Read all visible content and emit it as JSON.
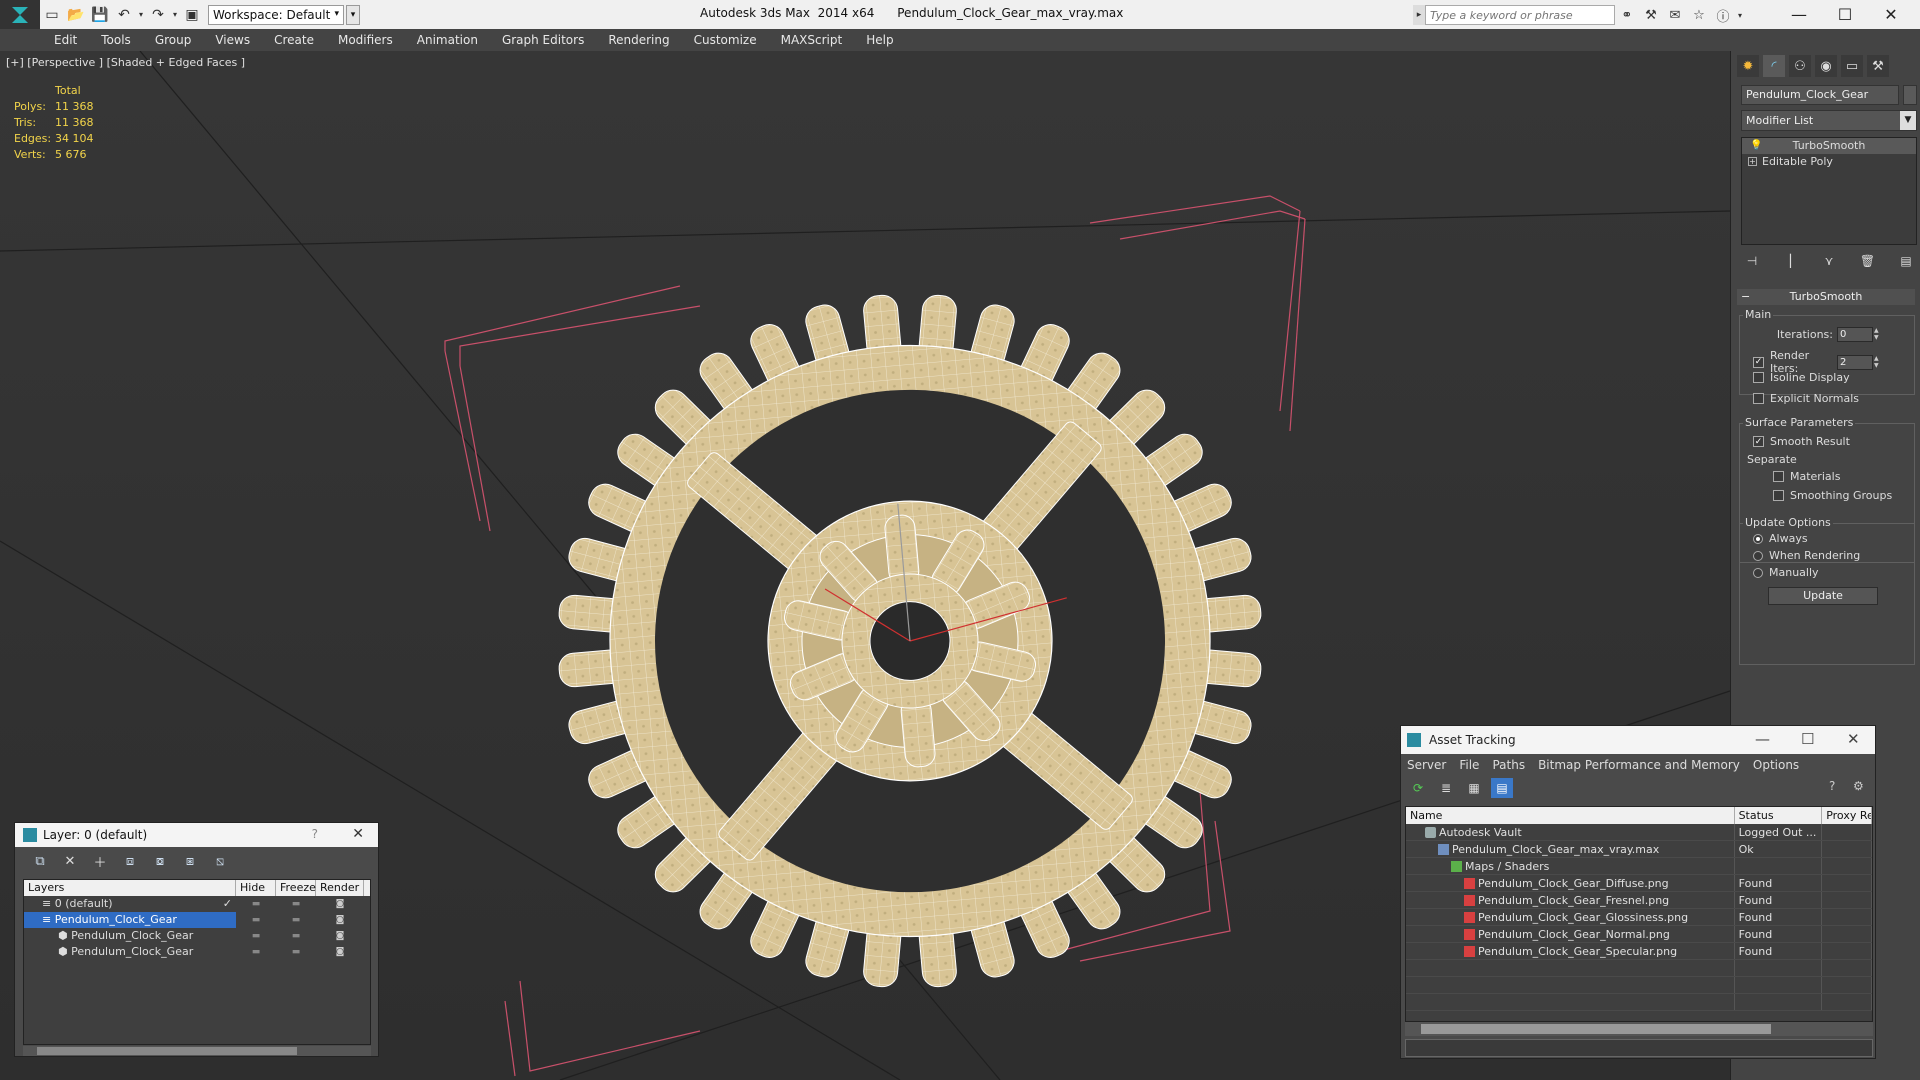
{
  "titlebar": {
    "workspace": "Workspace: Default",
    "app": "Autodesk 3ds Max  2014 x64",
    "file": "Pendulum_Clock_Gear_max_vray.max",
    "search_placeholder": "Type a keyword or phrase"
  },
  "menu": [
    "Edit",
    "Tools",
    "Group",
    "Views",
    "Create",
    "Modifiers",
    "Animation",
    "Graph Editors",
    "Rendering",
    "Customize",
    "MAXScript",
    "Help"
  ],
  "viewport": {
    "label": "[+] [Perspective ] [Shaded + Edged Faces ]",
    "stats": {
      "header": "Total",
      "rows": [
        {
          "k": "Polys:",
          "v": "11 368"
        },
        {
          "k": "Tris:",
          "v": "11 368"
        },
        {
          "k": "Edges:",
          "v": "34 104"
        },
        {
          "k": "Verts:",
          "v": "5 676"
        }
      ]
    }
  },
  "cmdpanel": {
    "object_name": "Pendulum_Clock_Gear",
    "modifier_list": "Modifier List",
    "stack": [
      "TurboSmooth",
      "Editable Poly"
    ],
    "rollout": "TurboSmooth",
    "main_label": "Main",
    "iterations_label": "Iterations:",
    "iterations_value": "0",
    "render_iters_label": "Render Iters:",
    "render_iters_value": "2",
    "isoline": "Isoline Display",
    "explicit_normals": "Explicit Normals",
    "surface_params": "Surface Parameters",
    "smooth_result": "Smooth Result",
    "separate": "Separate",
    "materials": "Materials",
    "smoothing_groups": "Smoothing Groups",
    "update_options": "Update Options",
    "always": "Always",
    "when_rendering": "When Rendering",
    "manually": "Manually",
    "update_button": "Update"
  },
  "layer_dialog": {
    "title": "Layer: 0 (default)",
    "help": "?",
    "headers": [
      "Layers",
      "Hide",
      "Freeze",
      "Render"
    ],
    "rows": [
      {
        "name": "0 (default)",
        "indent": 1
      },
      {
        "name": "Pendulum_Clock_Gear",
        "indent": 1
      },
      {
        "name": "Pendulum_Clock_Gear",
        "indent": 2
      },
      {
        "name": "Pendulum_Clock_Gear",
        "indent": 2
      }
    ]
  },
  "asset_dialog": {
    "title": "Asset Tracking",
    "menu": [
      "Server",
      "File",
      "Paths",
      "Bitmap Performance and Memory",
      "Options"
    ],
    "headers": [
      "Name",
      "Status",
      "Proxy Re"
    ],
    "rows": [
      {
        "name": "Autodesk Vault",
        "status": "Logged Out ...",
        "icon": "vault",
        "indent": 1
      },
      {
        "name": "Pendulum_Clock_Gear_max_vray.max",
        "status": "Ok",
        "icon": "max",
        "indent": 2
      },
      {
        "name": "Maps / Shaders",
        "status": "",
        "icon": "folder",
        "indent": 3
      },
      {
        "name": "Pendulum_Clock_Gear_Diffuse.png",
        "status": "Found",
        "icon": "png",
        "indent": 4
      },
      {
        "name": "Pendulum_Clock_Gear_Fresnel.png",
        "status": "Found",
        "icon": "png",
        "indent": 4
      },
      {
        "name": "Pendulum_Clock_Gear_Glossiness.png",
        "status": "Found",
        "icon": "png",
        "indent": 4
      },
      {
        "name": "Pendulum_Clock_Gear_Normal.png",
        "status": "Found",
        "icon": "png",
        "indent": 4
      },
      {
        "name": "Pendulum_Clock_Gear_Specular.png",
        "status": "Found",
        "icon": "png",
        "indent": 4
      }
    ]
  },
  "colors": {
    "gear": "#d8c495",
    "selection_bracket": "#c8506a",
    "stats_text": "#f2d44a",
    "selected_row": "#2f6cc4"
  }
}
